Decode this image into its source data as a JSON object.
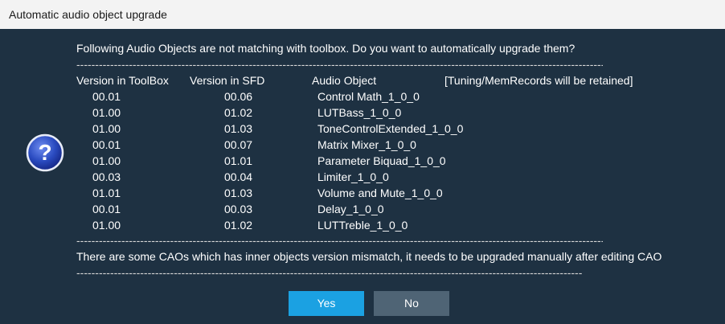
{
  "window": {
    "title": "Automatic audio object upgrade"
  },
  "message": {
    "intro": "Following Audio Objects are not matching with toolbox. Do you want to automatically upgrade them?",
    "separator": "--------------------------------------------------------------------------------------------------------------------------------------------------------",
    "note": "There are some CAOs which has inner objects version mismatch, it needs to be upgraded manually after editing CAO",
    "separator_short": "----------------------------------------------------------------------------------------------------------------------------------------------"
  },
  "table": {
    "headers": {
      "toolbox": "Version in ToolBox",
      "sfd": "Version in SFD",
      "object": "Audio Object",
      "retained": "[Tuning/MemRecords will be retained]"
    },
    "rows": [
      {
        "toolbox": "00.01",
        "sfd": "00.06",
        "object": "Control Math_1_0_0"
      },
      {
        "toolbox": "01.00",
        "sfd": "01.02",
        "object": "LUTBass_1_0_0"
      },
      {
        "toolbox": "01.00",
        "sfd": "01.03",
        "object": "ToneControlExtended_1_0_0"
      },
      {
        "toolbox": "00.01",
        "sfd": "00.07",
        "object": "Matrix Mixer_1_0_0"
      },
      {
        "toolbox": "01.00",
        "sfd": "01.01",
        "object": "Parameter Biquad_1_0_0"
      },
      {
        "toolbox": "00.03",
        "sfd": "00.04",
        "object": "Limiter_1_0_0"
      },
      {
        "toolbox": "01.01",
        "sfd": "01.03",
        "object": "Volume and Mute_1_0_0"
      },
      {
        "toolbox": "00.01",
        "sfd": "00.03",
        "object": "Delay_1_0_0"
      },
      {
        "toolbox": "01.00",
        "sfd": "01.02",
        "object": "LUTTreble_1_0_0"
      }
    ]
  },
  "buttons": {
    "yes": "Yes",
    "no": "No"
  },
  "icon": {
    "name": "question-icon",
    "glyph": "?",
    "color": "#2a4bc0"
  }
}
